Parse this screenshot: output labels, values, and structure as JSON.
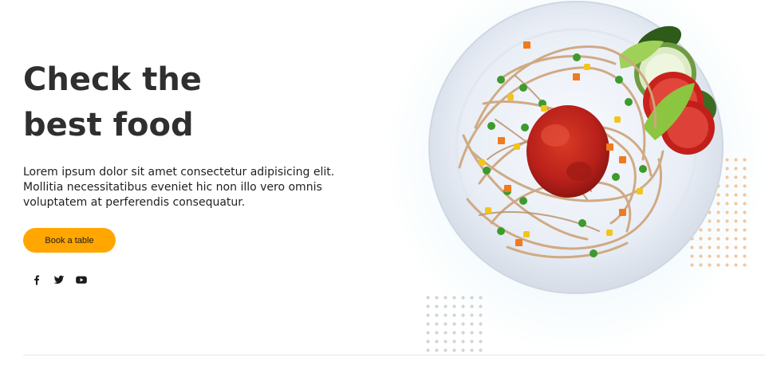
{
  "hero": {
    "title_line1": "Check the",
    "title_line2": "best food",
    "description": "Lorem ipsum dolor sit amet consectetur adipisicing elit. Mollitia necessitatibus eveniet hic non illo vero omnis voluptatem at perferendis consequatur.",
    "cta_label": "Book a table",
    "cta_color": "#ffa600",
    "social": [
      {
        "icon": "facebook-icon"
      },
      {
        "icon": "twitter-icon"
      },
      {
        "icon": "youtube-icon"
      }
    ],
    "image": {
      "icon": "spaghetti-plate-image"
    }
  }
}
